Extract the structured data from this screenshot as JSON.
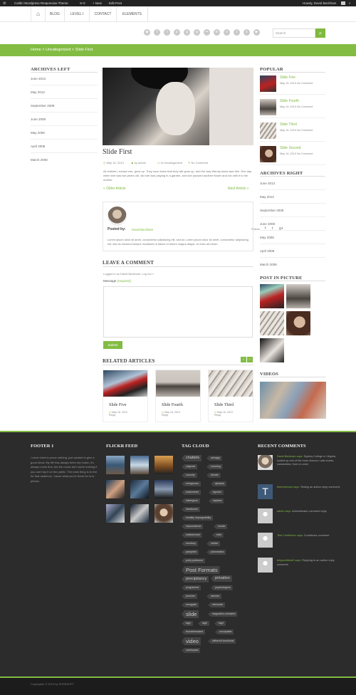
{
  "adminbar": {
    "wp_icon": "wordpress-icon",
    "site": "Calibri Wordpress Responsive Theme",
    "comments": "0",
    "new": "+ New",
    "edit": "Edit Post",
    "howdy": "Howdy, David Beckham"
  },
  "nav": {
    "home_icon": "home-icon",
    "items": [
      "BLOG",
      "LEVEL I",
      "CONTACT",
      "ELEMENTS"
    ]
  },
  "search": {
    "placeholder": "Search"
  },
  "social_icons": [
    "rss-icon",
    "facebook-icon",
    "twitter-icon",
    "pinterest-icon",
    "google-plus-icon",
    "dribbble-icon",
    "flickr-icon",
    "linkedin-icon",
    "vimeo-icon",
    "tumblr-icon",
    "skype-icon",
    "youtube-icon",
    "stumbleupon-icon",
    "foursquare-icon"
  ],
  "breadcrumb": "Home > Uncategorized > Slide First",
  "archives_left": {
    "title": "ARCHIVES LEFT",
    "items": [
      "June 2013",
      "May 2013",
      "September 2008",
      "June 2008",
      "May 2008",
      "April 2008",
      "March 2008"
    ]
  },
  "post": {
    "title": "Slide First",
    "date": "May 16, 2013",
    "author": "by admin",
    "category": "in Uncategorized",
    "comments": "No Comment",
    "excerpt": "Ali children, except one, grow up. They soon knew that they will grow up, and the way Wendy knew was this. One day when she was two years old. did she was playing in a garden, and she plucked another flower and ran with it to her mother.",
    "older": "« Older Article",
    "newer": "Next Article »"
  },
  "author_box": {
    "posted_by": "Posted by:",
    "name": "David Beckham",
    "follow": "Follow:",
    "bio": "Lorem ipsum dolor sit amet, consectetur adipisicing elit, sed do Lorem ipsum dolor sit amet, consectetur adipisicing elit, sed do eiusmod tempor incididunt ut labore et dolore magna aliqua. Ut enim ad minim"
  },
  "comment_form": {
    "title": "LEAVE A COMMENT",
    "logged": "Logged in as David Beckham. Log out »",
    "message_label": "Message",
    "required": "(required)",
    "submit": "Submit"
  },
  "related": {
    "title": "RELATED ARTICLES",
    "items": [
      {
        "title": "Slide Five",
        "date": "May 16, 2013",
        "reply": "Reply"
      },
      {
        "title": "Slide Fourth",
        "date": "May 16, 2013",
        "reply": "Reply"
      },
      {
        "title": "Slide Third",
        "date": "May 16, 2013",
        "reply": "Reply"
      }
    ]
  },
  "popular": {
    "title": "POPULAR",
    "items": [
      {
        "title": "Slide Five",
        "date": "May 16, 2013",
        "comments": "No Comment"
      },
      {
        "title": "Slide Fourth",
        "date": "May 16, 2013",
        "comments": "No Comment"
      },
      {
        "title": "Slide Third",
        "date": "May 16, 2013",
        "comments": "No Comment"
      },
      {
        "title": "Slide Second",
        "date": "May 16, 2013",
        "comments": "No Comment"
      }
    ]
  },
  "archives_right": {
    "title": "ARCHIVES RIGHT",
    "items": [
      "June 2013",
      "May 2013",
      "September 2008",
      "June 2008",
      "May 2008",
      "April 2008",
      "March 2008"
    ]
  },
  "post_in_picture": {
    "title": "POST IN PICTURE"
  },
  "videos": {
    "title": "VIDEOS"
  },
  "footer1": {
    "title": "FOOTER 1",
    "text": "I never tried to prove nothing, just wanted to give a good show. My life has always been my music, it's always come first, but the music ain't worth nothing if you can't lay it on the public. The main thing is to live for that audience, 'cause what you're there for is to please."
  },
  "flickr": {
    "title": "FLICKR FEED"
  },
  "tagcloud": {
    "title": "TAG CLOUD",
    "tags": [
      "chattels",
      "cienaga",
      "claycold",
      "crushing",
      "crunchy",
      "decide",
      "energumen",
      "aphasia",
      "eudiometer",
      "figurine",
      "habergeon",
      "hapless",
      "handsome",
      "hostility impregnability",
      "improvidence",
      "invoke",
      "misinformed",
      "mist",
      "monitory",
      "outlive",
      "pamphlet",
      "pneumatics",
      "porty portmove",
      "Post Formats",
      "precipitancy",
      "privation",
      "programme",
      "psychological",
      "puncher",
      "ramose",
      "renegade",
      "retrocede",
      "slide",
      "stagnation unhosted",
      "tag1",
      "tag2",
      "tag3",
      "thunderheaded",
      "unculpable",
      "video",
      "withered brandmist",
      "xanthopsia"
    ]
  },
  "recent_comments": {
    "title": "RECENT COMMENTS",
    "items": [
      {
        "author": "David Beckham says:",
        "text": "Sydney College in Virginia, looked up one of the more obscure Latin words, consectetur, from a Lorem"
      },
      {
        "author": "themedemos says:",
        "text": "Testing an author reply comment."
      },
      {
        "author": "admin says:",
        "text": "Administrator comment reply."
      },
      {
        "author": "Test Contributor says:",
        "text": "Contributor comment"
      },
      {
        "author": "tellyworthtest2 says:",
        "text": "Replying to an author reply comment."
      }
    ]
  },
  "copyright": "Copyrights © 2013 by KOPASOFT",
  "colors": {
    "accent": "#82bc43",
    "footer": "#2c2c2c",
    "adminbar": "#222222"
  }
}
